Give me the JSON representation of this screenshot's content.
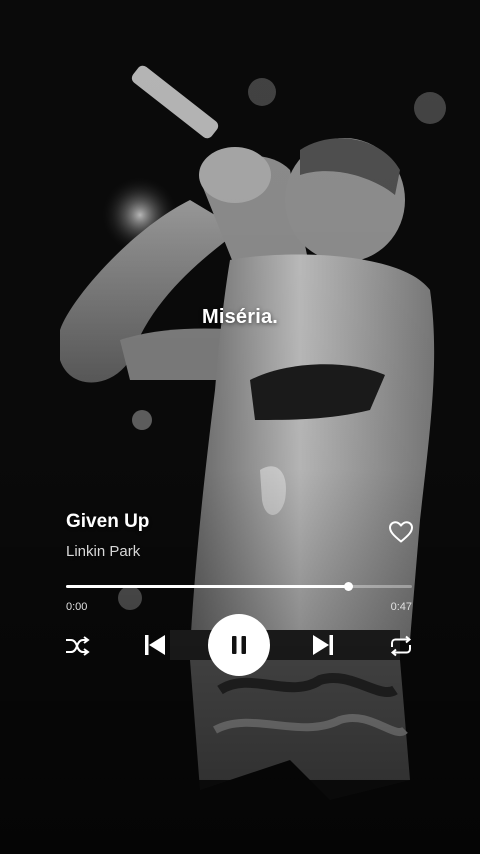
{
  "lyric": {
    "line": "Miséria."
  },
  "track": {
    "title": "Given Up",
    "artist": "Linkin Park",
    "liked": false
  },
  "playback": {
    "elapsed": "0:00",
    "total": "0:47",
    "progress_fraction": 0.815,
    "state": "playing"
  },
  "controls": {
    "shuffle_icon": "shuffle-icon",
    "previous_icon": "skip-previous-icon",
    "play_pause_icon": "pause-icon",
    "next_icon": "skip-next-icon",
    "repeat_icon": "repeat-icon",
    "like_icon": "heart-outline-icon"
  },
  "colors": {
    "foreground": "#ffffff",
    "track_inactive": "rgba(255,255,255,0.35)",
    "play_button_bg": "#ffffff",
    "play_button_icon": "#111111"
  }
}
